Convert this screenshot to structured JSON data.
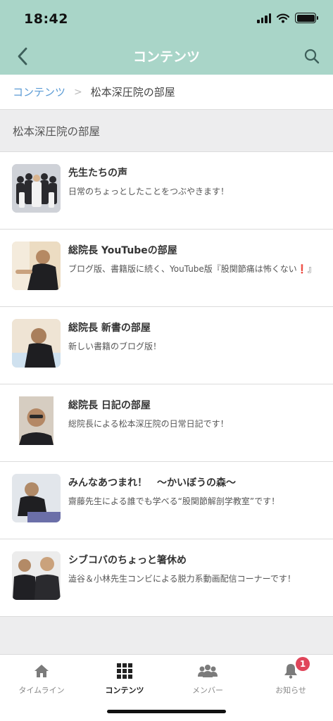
{
  "status_bar": {
    "time": "18:42"
  },
  "header": {
    "title": "コンテンツ",
    "back_icon": "chevron-left-icon",
    "search_icon": "search-icon"
  },
  "breadcrumb": {
    "root": "コンテンツ",
    "separator": ">",
    "current": "松本深圧院の部屋"
  },
  "section": {
    "title": "松本深圧院の部屋"
  },
  "items": [
    {
      "title": "先生たちの声",
      "desc": "日常のちょっとしたことをつぶやきます！",
      "thumb_bg": "#c9ccd3"
    },
    {
      "title": "総院長 YouTubeの部屋",
      "desc_text": "ブログ版、書籍版に続く、YouTube版『股関節痛は怖くない",
      "desc_mark": "❗",
      "desc_end": "』",
      "thumb_bg": "#e7d4b8"
    },
    {
      "title": "総院長 新書の部屋",
      "desc": "新しい書籍のブログ版！",
      "thumb_bg": "#e9dccb"
    },
    {
      "title": "総院長 日記の部屋",
      "desc": "総院長による松本深圧院の日常日記です！",
      "thumb_bg": "#d8cfc3"
    },
    {
      "title": "みんなあつまれ！　〜かいぼうの森〜",
      "desc": "齋藤先生による誰でも学べる“股関節解剖学教室”です！",
      "thumb_bg": "#dde2e8"
    },
    {
      "title": "シブコバのちょっと箸休め",
      "desc": "澁谷＆小林先生コンビによる脱力系動画配信コーナーです！",
      "thumb_bg": "#ebebeb"
    }
  ],
  "tabbar": {
    "tabs": [
      {
        "label": "タイムライン",
        "icon": "home-icon"
      },
      {
        "label": "コンテンツ",
        "icon": "grid-icon"
      },
      {
        "label": "メンバー",
        "icon": "members-icon"
      },
      {
        "label": "お知らせ",
        "icon": "bell-icon",
        "badge": "1"
      }
    ],
    "active_index": 1
  },
  "colors": {
    "header_bg": "#a9d5c8",
    "link": "#5b9bd5",
    "badge": "#e0455a"
  }
}
